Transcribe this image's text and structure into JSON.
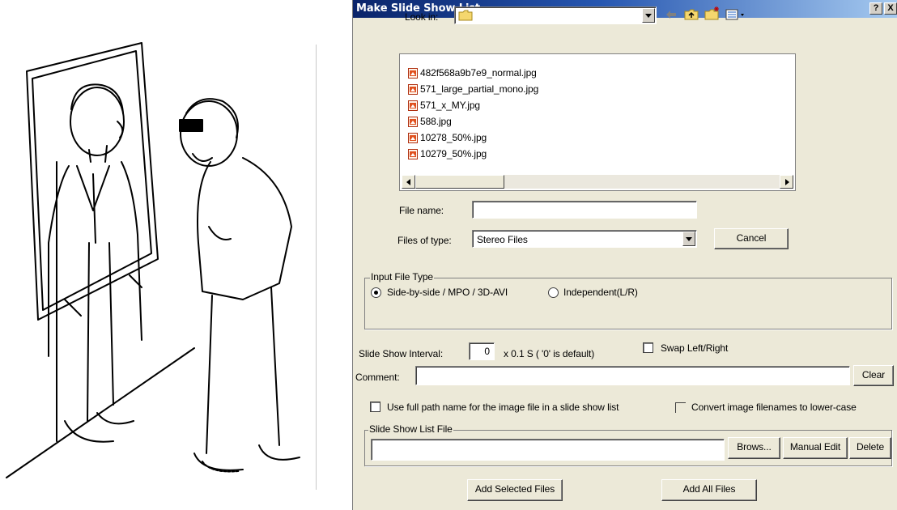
{
  "dialog": {
    "title": "Make Slide Show List",
    "help_label": "?",
    "close_label": "X",
    "look_in_label": "Look in:",
    "look_in_value": "",
    "files": [
      {
        "name": "482f568a9b7e9_normal.jpg"
      },
      {
        "name": "571_large_partial_mono.jpg"
      },
      {
        "name": "571_x_MY.jpg"
      },
      {
        "name": "588.jpg"
      },
      {
        "name": "10278_50%.jpg"
      },
      {
        "name": "10279_50%.jpg"
      }
    ],
    "file_name_label": "File name:",
    "file_name_value": "",
    "files_of_type_label": "Files of type:",
    "files_of_type_value": "Stereo Files",
    "cancel_label": "Cancel",
    "input_file_type_label": "Input File Type",
    "radio_side_by_side": "Side-by-side / MPO / 3D-AVI",
    "radio_independent": "Independent(L/R)",
    "selected_input_type": "Side-by-side / MPO / 3D-AVI",
    "interval_label": "Slide Show Interval:",
    "interval_value": "0",
    "interval_hint": "x 0.1 S ( '0' is default)",
    "swap_label": "Swap Left/Right",
    "swap_checked": false,
    "comment_label": "Comment:",
    "comment_value": "",
    "clear_label": "Clear",
    "full_path_label": "Use full path name for the image file in a slide show list",
    "full_path_checked": false,
    "lowercase_label": "Convert image filenames to lower-case",
    "lowercase_checked": false,
    "list_file_label": "Slide Show List File",
    "list_file_value": "",
    "browse_label": "Brows...",
    "manual_edit_label": "Manual Edit",
    "delete_label": "Delete",
    "add_selected_label": "Add Selected Files",
    "add_all_label": "Add All Files"
  },
  "colors": {
    "title_start": "#0a246a",
    "title_end": "#a6caf0",
    "dialog_bg": "#ece9d8",
    "folder_yellow": "#f5d76e",
    "file_icon_orange": "#e0501e"
  },
  "icons": {
    "folder": "folder-icon",
    "back": "back-arrow-icon",
    "up": "up-folder-icon",
    "new_folder": "new-folder-icon",
    "view_menu": "view-menu-icon",
    "file": "image-file-icon"
  }
}
